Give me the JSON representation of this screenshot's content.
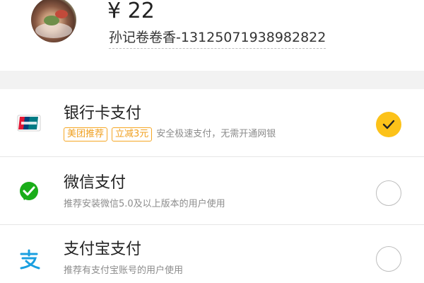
{
  "order": {
    "amount": "¥ 22",
    "merchant": "孙记卷卷香-13125071938982822"
  },
  "payment_methods": [
    {
      "title": "银行卡支付",
      "tags": [
        "美团推荐",
        "立减3元"
      ],
      "description": "安全极速支付，无需开通网银",
      "icon": "unionpay-card-icon",
      "selected": true
    },
    {
      "title": "微信支付",
      "description": "推荐安装微信5.0及以上版本的用户使用",
      "icon": "wechat-pay-icon",
      "selected": false
    },
    {
      "title": "支付宝支付",
      "description": "推荐有支付宝账号的用户使用",
      "icon": "alipay-icon",
      "selected": false
    }
  ],
  "colors": {
    "accent_yellow": "#fcc219",
    "tag_orange": "#f5a623",
    "wechat_green": "#1aad19",
    "alipay_blue": "#1a9fe0"
  }
}
